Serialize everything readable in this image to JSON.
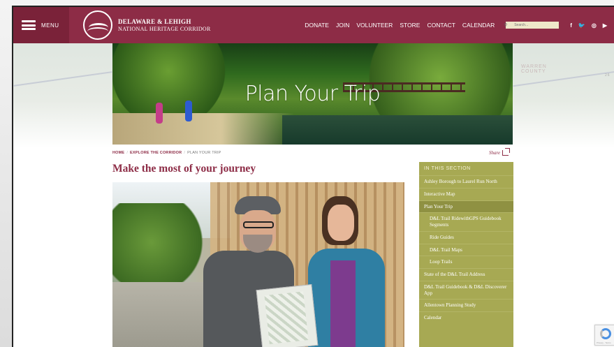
{
  "header": {
    "menu_label": "MENU",
    "logo_line1": "DELAWARE & LEHIGH",
    "logo_line2": "NATIONAL HERITAGE CORRIDOR",
    "nav": [
      "DONATE",
      "JOIN",
      "VOLUNTEER",
      "STORE",
      "CONTACT",
      "CALENDAR"
    ],
    "search_placeholder": "Search...",
    "socials": [
      "f",
      "t",
      "ig",
      "yt"
    ]
  },
  "map": {
    "left_label": "",
    "right_label": "WARREN\nCOUNTY",
    "right_number": "26"
  },
  "hero": {
    "title": "Plan Your Trip"
  },
  "breadcrumb": {
    "home": "HOME",
    "section": "EXPLORE THE CORRIDOR",
    "current": "PLAN YOUR TRIP",
    "separator": "/"
  },
  "share_label": "Share",
  "page_title": "Make the most of your journey",
  "sidebar": {
    "heading": "IN THIS SECTION",
    "items": [
      {
        "label": "Ashley Borough to Laurel Run North",
        "sub": false,
        "active": false
      },
      {
        "label": "Interactive Map",
        "sub": false,
        "active": false
      },
      {
        "label": "Plan Your Trip",
        "sub": false,
        "active": true
      },
      {
        "label": "D&L Trail RidewithGPS Guidebook Segments",
        "sub": true,
        "active": false
      },
      {
        "label": "Ride Guides",
        "sub": true,
        "active": false
      },
      {
        "label": "D&L Trail Maps",
        "sub": true,
        "active": false
      },
      {
        "label": "Loop Trails",
        "sub": true,
        "active": false
      },
      {
        "label": "State of the D&L Trail Address",
        "sub": false,
        "active": false
      },
      {
        "label": "D&L Trail Guidebook & D&L Discoverer App",
        "sub": false,
        "active": false
      },
      {
        "label": "Allentown Planning Study",
        "sub": false,
        "active": false
      },
      {
        "label": "Calendar",
        "sub": false,
        "active": false
      }
    ]
  },
  "captcha_text": "Privacy - Terms",
  "colors": {
    "brand": "#8d2c46",
    "sidebar": "#a7a953",
    "search_bg": "#eee7c9"
  }
}
